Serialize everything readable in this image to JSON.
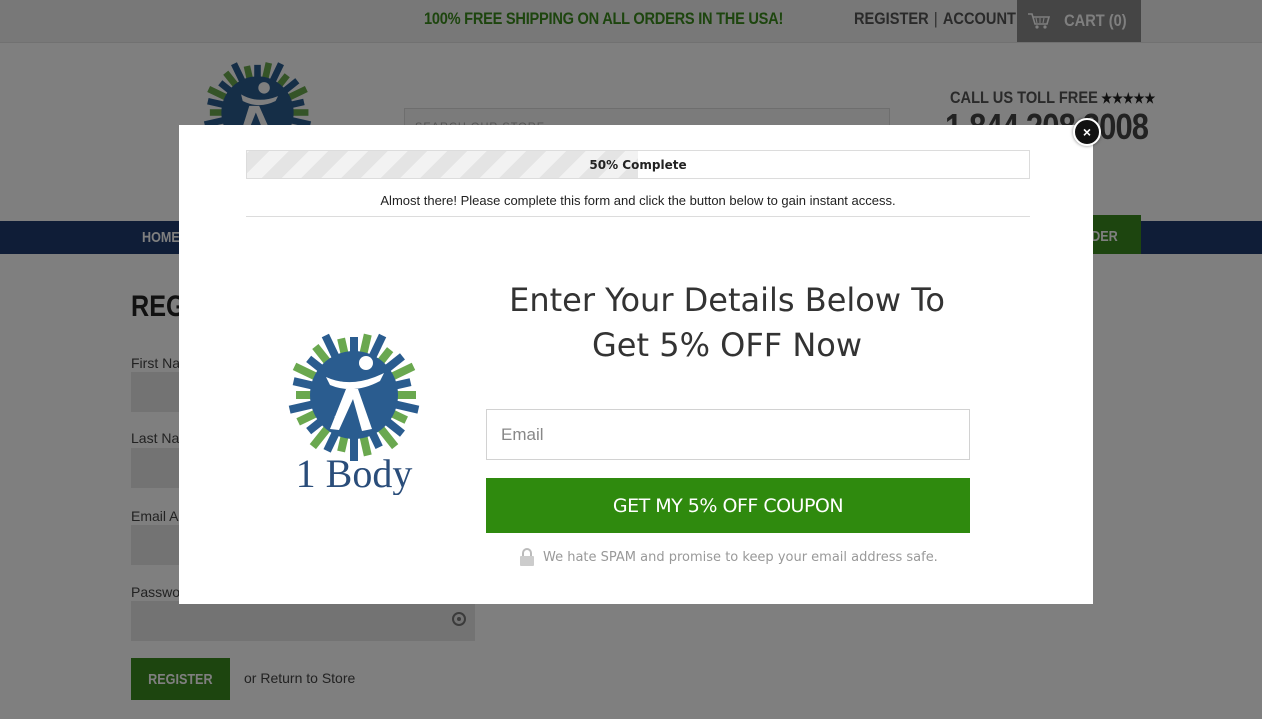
{
  "topbar": {
    "shipping_banner": "100% FREE SHIPPING ON ALL ORDERS IN THE USA!",
    "register_link": "REGISTER",
    "separator": "|",
    "account_link": "ACCOUNT",
    "cart_label": "CART (0)",
    "cart_icon": "shopping-cart-icon"
  },
  "header": {
    "search_placeholder": "SEARCH OUR STORE",
    "call_label": "CALL US TOLL FREE",
    "stars": "★★★★★",
    "phone_partial": "1 844 208 3008"
  },
  "nav": {
    "home_label": "HOME",
    "order_label": "RDER"
  },
  "register_form": {
    "title": "REGI",
    "first_name_label": "First Na",
    "last_name_label": "Last Na",
    "email_label": "Email A",
    "password_label": "Passwo",
    "register_button": "REGISTER",
    "return_link": "or Return to Store"
  },
  "modal": {
    "progress_percent": 50,
    "progress_text": "50% Complete",
    "instructions": "Almost there! Please complete this form and click the button below to gain instant access.",
    "headline_line1": "Enter Your Details Below To",
    "headline_line2": "Get 5% OFF Now",
    "logo_text": "1 Body",
    "email_placeholder": "Email",
    "email_value": "",
    "cta_label": "GET MY 5% OFF COUPON",
    "spam_note": "We hate SPAM and promise to keep your email address safe.",
    "close_label": "×"
  },
  "colors": {
    "brand_green": "#2f8a0e",
    "nav_blue": "#1f3b6f",
    "logo_blue": "#2a5c8f",
    "logo_green": "#6aa84f",
    "logo_text": "#2a4d7a"
  }
}
